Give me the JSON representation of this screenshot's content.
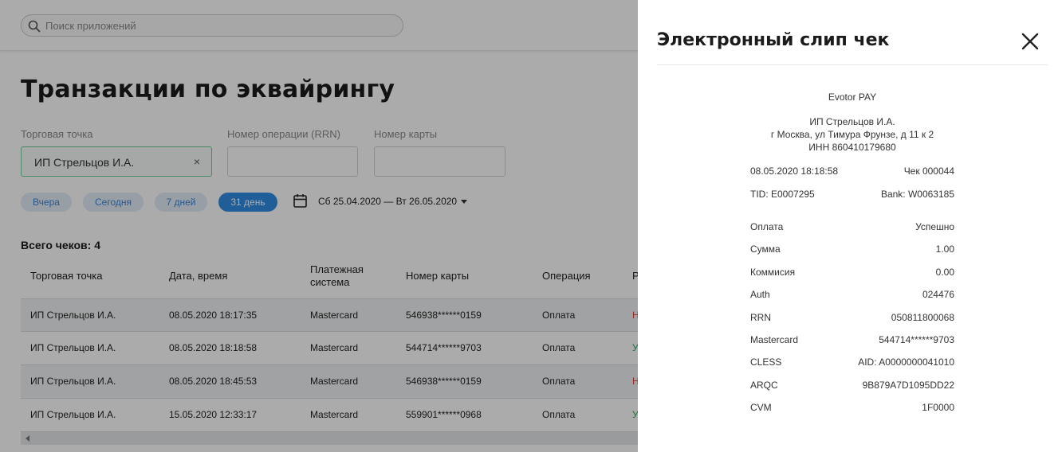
{
  "search": {
    "placeholder": "Поиск приложений"
  },
  "page": {
    "title": "Транзакции по эквайрингу"
  },
  "filters": {
    "merchant": {
      "label": "Торговая точка",
      "value": "ИП Стрельцов И.А.",
      "clear": "×"
    },
    "rrn": {
      "label": "Номер операции (RRN)",
      "value": ""
    },
    "card": {
      "label": "Номер карты",
      "value": ""
    }
  },
  "period_chips": [
    "Вчера",
    "Сегодня",
    "7 дней",
    "31 день"
  ],
  "active_chip": "31 день",
  "date_range": "Сб 25.04.2020 — Вт 26.05.2020",
  "total": "Всего чеков: 4",
  "table": {
    "headers": [
      "Торговая точка",
      "Дата, время",
      "Платежная система",
      "Номер карты",
      "Операция",
      "Р"
    ],
    "header_system_lines": [
      "Платежная",
      "система"
    ],
    "rows": [
      {
        "merchant": "ИП Стрельцов И.А.",
        "datetime": "08.05.2020 18:17:35",
        "system": "Mastercard",
        "card": "546938******0159",
        "operation": "Оплата",
        "result": "Н",
        "status": "error"
      },
      {
        "merchant": "ИП Стрельцов И.А.",
        "datetime": "08.05.2020 18:18:58",
        "system": "Mastercard",
        "card": "544714******9703",
        "operation": "Оплата",
        "result": "У",
        "status": "success"
      },
      {
        "merchant": "ИП Стрельцов И.А.",
        "datetime": "08.05.2020 18:45:53",
        "system": "Mastercard",
        "card": "546938******0159",
        "operation": "Оплата",
        "result": "Н",
        "status": "error"
      },
      {
        "merchant": "ИП Стрельцов И.А.",
        "datetime": "15.05.2020 12:33:17",
        "system": "Mastercard",
        "card": "559901******0968",
        "operation": "Оплата",
        "result": "У",
        "status": "success"
      }
    ]
  },
  "slip": {
    "title": "Электронный слип чек",
    "brand": "Evotor PAY",
    "merchant_lines": [
      "ИП Стрельцов И.А.",
      "г Москва, ул Тимура Фрунзе, д 11 к 2",
      "ИНН 860410179680"
    ],
    "datetime": "08.05.2020 18:18:58",
    "check": "Чек 000044",
    "tid": "TID: E0007295",
    "bank": "Bank: W0063185",
    "fields": [
      {
        "label": "Оплата",
        "value": "Успешно"
      },
      {
        "label": "Сумма",
        "value": "1.00"
      },
      {
        "label": "Коммисия",
        "value": "0.00"
      },
      {
        "label": "Auth",
        "value": "024476"
      },
      {
        "label": "RRN",
        "value": "050811800068"
      },
      {
        "label": "Mastercard",
        "value": "544714******9703"
      },
      {
        "label": "CLESS",
        "value": "AID: A0000000041010"
      },
      {
        "label": "ARQC",
        "value": "9B879A7D1095DD22"
      },
      {
        "label": "CVM",
        "value": "1F0000"
      }
    ]
  },
  "colors": {
    "accent": "#2f8de4",
    "error": "#e53935",
    "success": "#27ae60",
    "active_field": "#6fcf97"
  },
  "icons": {
    "search": "search-icon",
    "calendar": "calendar-icon",
    "close": "close-icon",
    "caret": "chevron-down-icon",
    "scroll_left": "arrow-left-icon"
  }
}
